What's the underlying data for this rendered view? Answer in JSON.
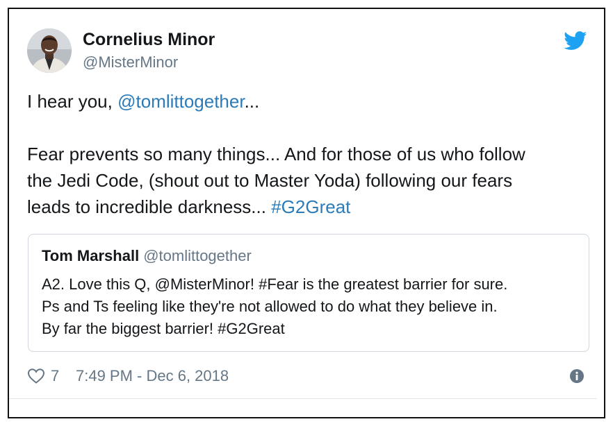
{
  "tweet": {
    "author": {
      "name": "Cornelius Minor",
      "handle": "@MisterMinor"
    },
    "body": {
      "p1_prefix": "I hear you, ",
      "p1_mention": "@tomlittogether",
      "p1_suffix": "...",
      "p2_line1": "Fear prevents so many things... And for those of us who follow",
      "p2_line2": "the Jedi Code, (shout out to Master Yoda) following our fears",
      "p2_line3_text": "leads to incredible darkness... ",
      "p2_hashtag": "#G2Great"
    },
    "quoted": {
      "name": "Tom Marshall",
      "handle": "@tomlittogether",
      "line1": "A2. Love this Q, @MisterMinor! #Fear is the greatest barrier for sure.",
      "line2": "Ps and Ts feeling like they're not allowed to do what they believe in.",
      "line3": "By far the biggest barrier! #G2Great"
    },
    "footer": {
      "like_count": "7",
      "timestamp": "7:49 PM - Dec 6, 2018"
    },
    "colors": {
      "link": "#2b7bb9",
      "twitter_blue": "#1da1f2",
      "muted": "#657786",
      "text": "#14171a"
    },
    "icons": {
      "brand": "twitter-bird-icon",
      "like": "heart-icon",
      "info": "info-icon"
    }
  }
}
